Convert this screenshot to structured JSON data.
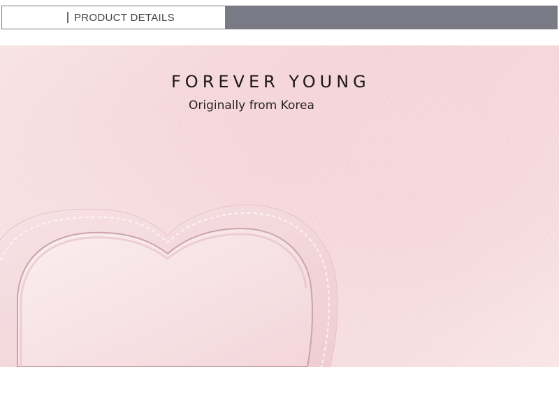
{
  "header": {
    "title": "PRODUCT DETAILS"
  },
  "product": {
    "brand_name": "FOREVER YOUNG",
    "tagline": "Originally from Korea",
    "leather_color": "#f5dadd",
    "accent_color": "#7a7a86"
  }
}
